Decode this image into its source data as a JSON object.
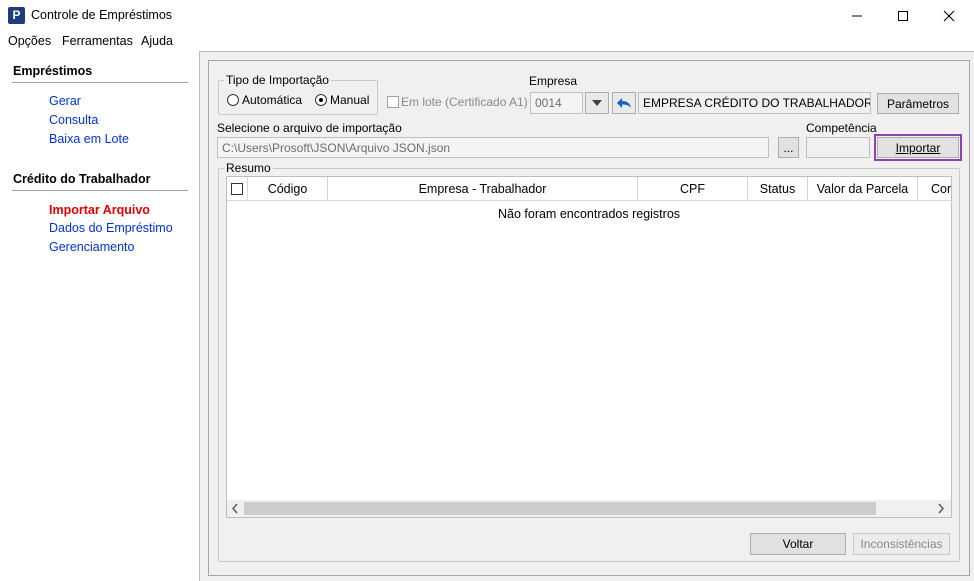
{
  "window": {
    "icon_letter": "P",
    "title": "Controle de Empréstimos"
  },
  "menu": [
    "Opções",
    "Ferramentas",
    "Ajuda"
  ],
  "sidebar": {
    "sections": [
      {
        "title": "Empréstimos",
        "items": [
          "Gerar",
          "Consulta",
          "Baixa em Lote"
        ]
      },
      {
        "title": "Crédito do Trabalhador",
        "items": [
          "Importar Arquivo",
          "Dados do Empréstimo",
          "Gerenciamento"
        ]
      }
    ],
    "active_item": "Importar Arquivo"
  },
  "form": {
    "tipo_importacao": {
      "label": "Tipo de Importação",
      "options": [
        "Automática",
        "Manual"
      ],
      "selected": "Manual"
    },
    "em_lote": {
      "label": "Em lote (Certificado A1)",
      "checked": false,
      "enabled": false
    },
    "empresa": {
      "label": "Empresa",
      "code": "0014",
      "name": "EMPRESA CRÉDITO DO TRABALHADOR"
    },
    "parametros_label": "Parâmetros",
    "arquivo": {
      "label": "Selecione o arquivo de importação",
      "path": "C:\\Users\\Prosoft\\JSON\\Arquivo JSON.json",
      "browse_label": "..."
    },
    "competencia": {
      "label": "Competência",
      "value": ""
    },
    "importar_label": "Importar"
  },
  "resumo": {
    "title": "Resumo",
    "columns": [
      "Código",
      "Empresa - Trabalhador",
      "CPF",
      "Status",
      "Valor da Parcela",
      "Cor"
    ],
    "empty_message": "Não foram encontrados registros"
  },
  "footer": {
    "voltar_label": "Voltar",
    "inconsistencias_label": "Inconsistências"
  },
  "colors": {
    "active_link": "#e00000",
    "link": "#0033cc",
    "highlight_border": "#8e44ad"
  }
}
